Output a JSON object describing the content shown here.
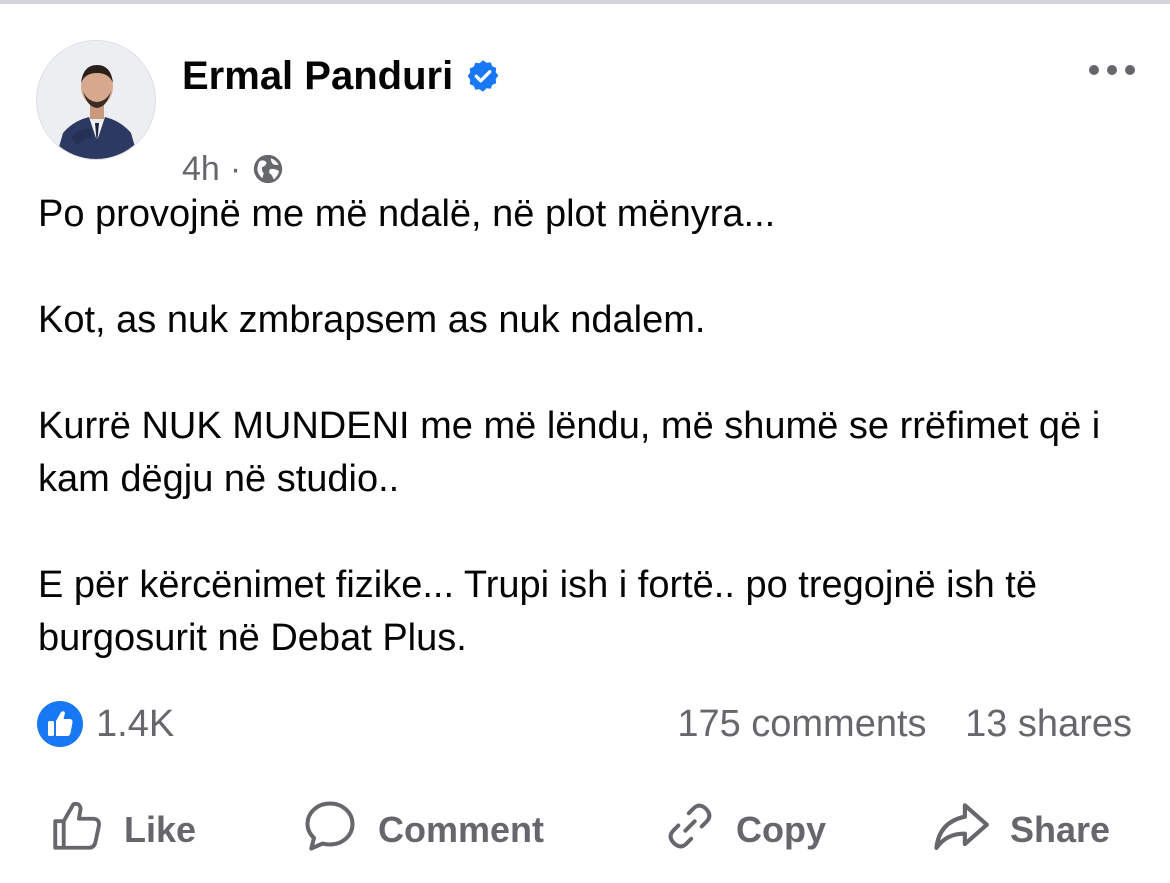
{
  "post": {
    "author": "Ermal Panduri",
    "time": "4h",
    "separator": "·",
    "paragraphs": [
      "Po provojnë me më ndalë, në plot mënyra...",
      "Kot, as nuk zmbrapsem as nuk ndalem.",
      "Kurrë NUK MUNDENI me më lëndu, më shumë se rrëfimet që i kam dëgju në studio..",
      "E për kërcënimet fizike... Trupi ish i fortë.. po tregojnë ish të burgosurit në Debat Plus."
    ]
  },
  "stats": {
    "likes": "1.4K",
    "comments": "175 comments",
    "shares": "13 shares"
  },
  "actions": {
    "like": "Like",
    "comment": "Comment",
    "copy": "Copy",
    "share": "Share"
  },
  "icons": {
    "verified": "verified-badge-icon",
    "audience": "globe-icon",
    "more": "more-options-icon",
    "reaction": "like-reaction-icon"
  },
  "colors": {
    "brand_blue": "#1877f2",
    "secondary_text": "#65676b",
    "primary_text": "#050505"
  }
}
